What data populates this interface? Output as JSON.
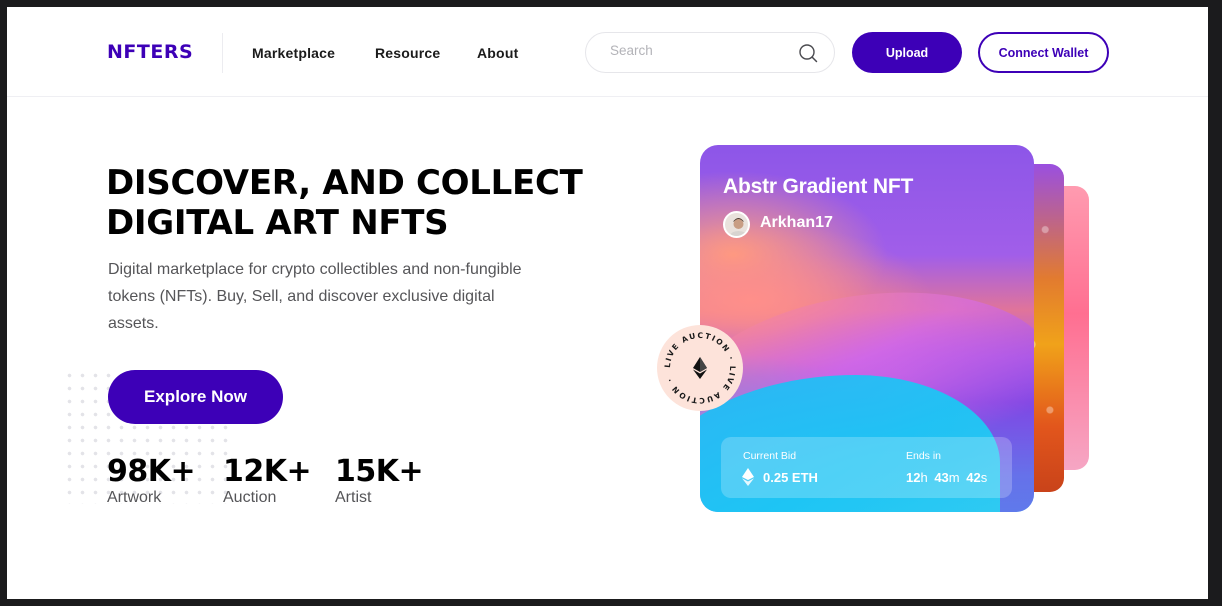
{
  "nav": {
    "logo": "NFTERS",
    "links": [
      "Marketplace",
      "Resource",
      "About"
    ],
    "search_placeholder": "Search",
    "upload_label": "Upload",
    "connect_wallet_label": "Connect Wallet"
  },
  "hero": {
    "title": "DISCOVER, AND COLLECT\nDIGITAL ART  NFTS",
    "description": "Digital marketplace for crypto collectibles and non-fungible tokens (NFTs). Buy, Sell, and discover exclusive digital assets.",
    "cta_label": "Explore Now",
    "stats": [
      {
        "value": "98K+",
        "label": "Artwork"
      },
      {
        "value": "12K+",
        "label": "Auction"
      },
      {
        "value": "15K+",
        "label": "Artist"
      }
    ]
  },
  "card": {
    "title": "Abstr Gradient NFT",
    "creator": "Arkhan17",
    "current_bid_label": "Current Bid",
    "current_bid_value": "0.25 ETH",
    "ends_in_label": "Ends in",
    "ends_in": {
      "hours": "12",
      "hours_unit": "h",
      "minutes": "43",
      "minutes_unit": "m",
      "seconds": "42",
      "seconds_unit": "s"
    },
    "badge_text": "LIVE AUCTION · LIVE AUCTION ·"
  },
  "colors": {
    "brand": "#3d00b7",
    "text_dark": "#000000",
    "text_muted": "#555558"
  }
}
